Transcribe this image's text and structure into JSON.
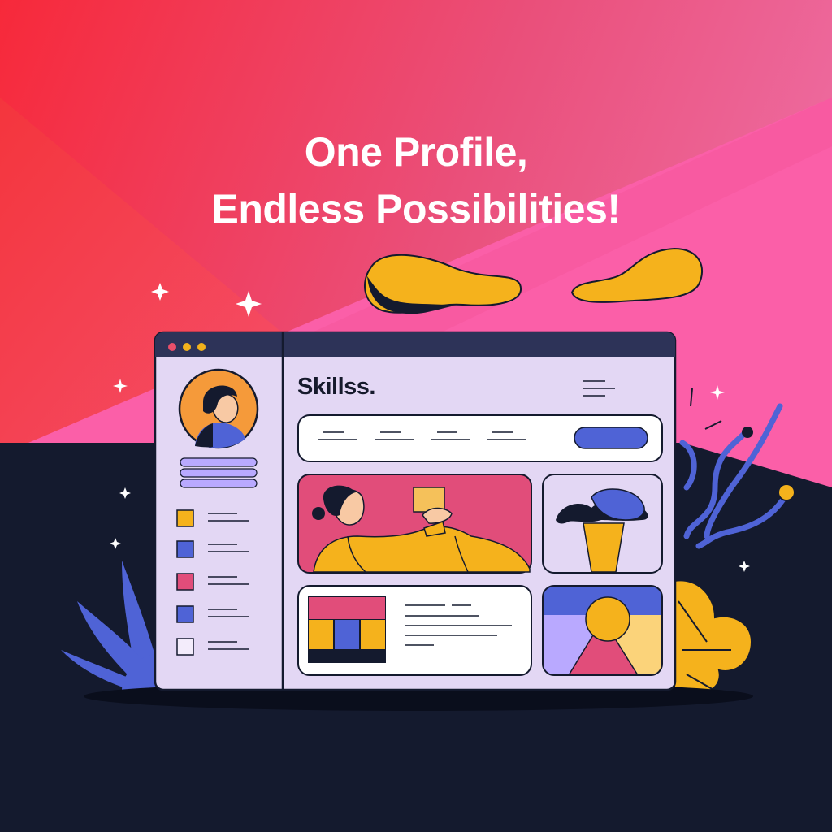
{
  "headline": {
    "line1": "One Profile,",
    "line2": "Endless Possibilities!"
  },
  "app": {
    "brand": "Skillss.",
    "window_dots": [
      "#e94f6a",
      "#f2b21c",
      "#f2b21c"
    ]
  },
  "colors": {
    "red": "#f5323c",
    "pink": "#fb5fa6",
    "navy": "#141a2e",
    "lavender": "#e3d7f4",
    "yellow": "#f5b21c",
    "blue": "#4f63d6",
    "magenta": "#e14d7a"
  },
  "icons": [
    "hamburger-menu-icon",
    "avatar",
    "sparkle-icon",
    "leaf-icon",
    "cloud-icon"
  ]
}
